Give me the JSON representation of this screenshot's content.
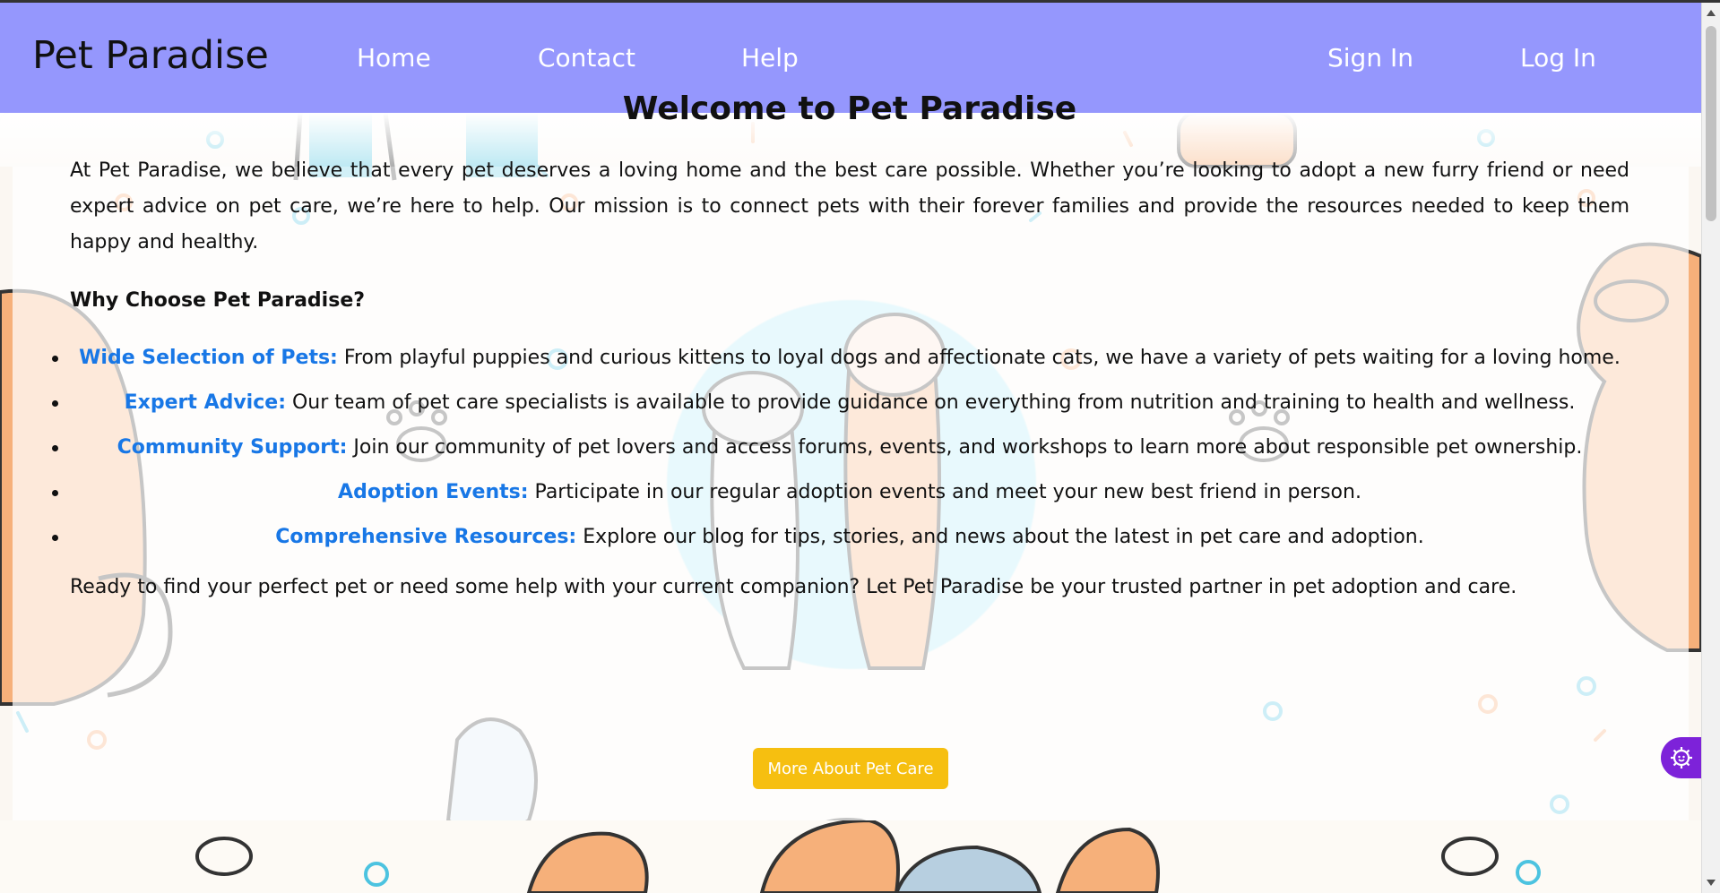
{
  "navbar": {
    "brand": "Pet Paradise",
    "links": [
      "Home",
      "Contact",
      "Help"
    ],
    "sign_in": "Sign In",
    "log_in": "Log In"
  },
  "main": {
    "title": "Welcome to Pet Paradise",
    "intro": "At Pet Paradise, we believe that every pet deserves a loving home and the best care possible. Whether you’re looking to adopt a new furry friend or need expert advice on pet care, we’re here to help. Our mission is to connect pets with their forever families and provide the resources needed to keep them happy and healthy.",
    "why_heading": "Why Choose Pet Paradise?",
    "features": [
      {
        "title": "Wide Selection of Pets:",
        "text": " From playful puppies and curious kittens to loyal dogs and affectionate cats, we have a variety of pets waiting for a loving home."
      },
      {
        "title": "Expert Advice:",
        "text": " Our team of pet care specialists is available to provide guidance on everything from nutrition and training to health and wellness."
      },
      {
        "title": "Community Support:",
        "text": " Join our community of pet lovers and access forums, events, and workshops to learn more about responsible pet ownership."
      },
      {
        "title": "Adoption Events:",
        "text": " Participate in our regular adoption events and meet your new best friend in person."
      },
      {
        "title": "Comprehensive Resources:",
        "text": " Explore our blog for tips, stories, and news about the latest in pet care and adoption."
      }
    ],
    "closing": "Ready to find your perfect pet or need some help with your current companion? Let Pet Paradise be your trusted partner in pet adoption and care.",
    "cta": "More About Pet Care"
  },
  "icons": {
    "accessibility_widget": "gear-icon"
  },
  "colors": {
    "navbar": "#9597fd",
    "accent": "#1877e6",
    "button": "#f6bf10",
    "widget": "#7d22d9"
  }
}
